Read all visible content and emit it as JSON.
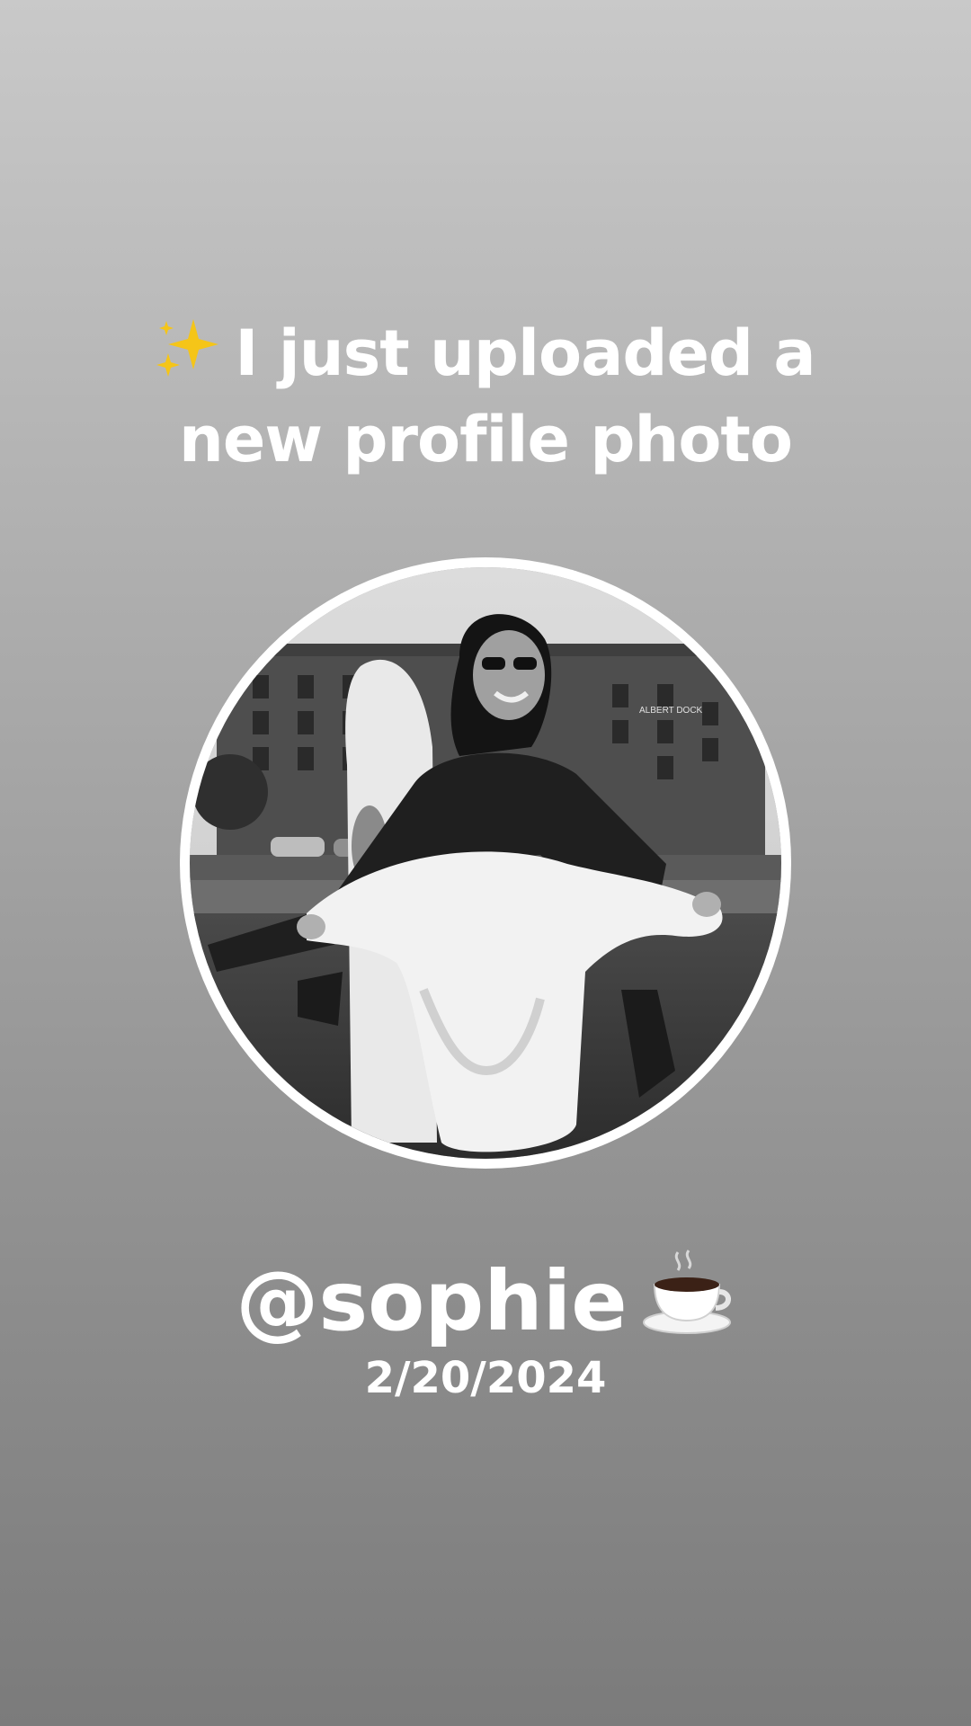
{
  "headline": {
    "line1": "I just uploaded a",
    "line2": "new profile photo",
    "leading_icon": "sparkles-icon"
  },
  "profile_photo": {
    "alt": "Profile photo",
    "storefront_sign": "ALBERT DOCK"
  },
  "user": {
    "handle": "@sophie",
    "trailing_icon": "coffee-cup-icon"
  },
  "date": "2/20/2024",
  "colors": {
    "background_top": "#c9c9c9",
    "background_bottom": "#7b7b7b",
    "text": "#ffffff",
    "ring": "#ffffff",
    "sparkle": "#f5c518"
  }
}
